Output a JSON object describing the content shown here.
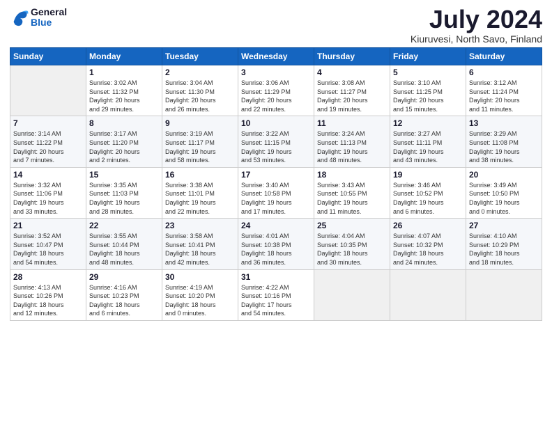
{
  "logo": {
    "line1": "General",
    "line2": "Blue"
  },
  "title": "July 2024",
  "subtitle": "Kiuruvesi, North Savo, Finland",
  "days_of_week": [
    "Sunday",
    "Monday",
    "Tuesday",
    "Wednesday",
    "Thursday",
    "Friday",
    "Saturday"
  ],
  "weeks": [
    [
      {
        "day": "",
        "info": ""
      },
      {
        "day": "1",
        "info": "Sunrise: 3:02 AM\nSunset: 11:32 PM\nDaylight: 20 hours\nand 29 minutes."
      },
      {
        "day": "2",
        "info": "Sunrise: 3:04 AM\nSunset: 11:30 PM\nDaylight: 20 hours\nand 26 minutes."
      },
      {
        "day": "3",
        "info": "Sunrise: 3:06 AM\nSunset: 11:29 PM\nDaylight: 20 hours\nand 22 minutes."
      },
      {
        "day": "4",
        "info": "Sunrise: 3:08 AM\nSunset: 11:27 PM\nDaylight: 20 hours\nand 19 minutes."
      },
      {
        "day": "5",
        "info": "Sunrise: 3:10 AM\nSunset: 11:25 PM\nDaylight: 20 hours\nand 15 minutes."
      },
      {
        "day": "6",
        "info": "Sunrise: 3:12 AM\nSunset: 11:24 PM\nDaylight: 20 hours\nand 11 minutes."
      }
    ],
    [
      {
        "day": "7",
        "info": "Sunrise: 3:14 AM\nSunset: 11:22 PM\nDaylight: 20 hours\nand 7 minutes."
      },
      {
        "day": "8",
        "info": "Sunrise: 3:17 AM\nSunset: 11:20 PM\nDaylight: 20 hours\nand 2 minutes."
      },
      {
        "day": "9",
        "info": "Sunrise: 3:19 AM\nSunset: 11:17 PM\nDaylight: 19 hours\nand 58 minutes."
      },
      {
        "day": "10",
        "info": "Sunrise: 3:22 AM\nSunset: 11:15 PM\nDaylight: 19 hours\nand 53 minutes."
      },
      {
        "day": "11",
        "info": "Sunrise: 3:24 AM\nSunset: 11:13 PM\nDaylight: 19 hours\nand 48 minutes."
      },
      {
        "day": "12",
        "info": "Sunrise: 3:27 AM\nSunset: 11:11 PM\nDaylight: 19 hours\nand 43 minutes."
      },
      {
        "day": "13",
        "info": "Sunrise: 3:29 AM\nSunset: 11:08 PM\nDaylight: 19 hours\nand 38 minutes."
      }
    ],
    [
      {
        "day": "14",
        "info": "Sunrise: 3:32 AM\nSunset: 11:06 PM\nDaylight: 19 hours\nand 33 minutes."
      },
      {
        "day": "15",
        "info": "Sunrise: 3:35 AM\nSunset: 11:03 PM\nDaylight: 19 hours\nand 28 minutes."
      },
      {
        "day": "16",
        "info": "Sunrise: 3:38 AM\nSunset: 11:01 PM\nDaylight: 19 hours\nand 22 minutes."
      },
      {
        "day": "17",
        "info": "Sunrise: 3:40 AM\nSunset: 10:58 PM\nDaylight: 19 hours\nand 17 minutes."
      },
      {
        "day": "18",
        "info": "Sunrise: 3:43 AM\nSunset: 10:55 PM\nDaylight: 19 hours\nand 11 minutes."
      },
      {
        "day": "19",
        "info": "Sunrise: 3:46 AM\nSunset: 10:52 PM\nDaylight: 19 hours\nand 6 minutes."
      },
      {
        "day": "20",
        "info": "Sunrise: 3:49 AM\nSunset: 10:50 PM\nDaylight: 19 hours\nand 0 minutes."
      }
    ],
    [
      {
        "day": "21",
        "info": "Sunrise: 3:52 AM\nSunset: 10:47 PM\nDaylight: 18 hours\nand 54 minutes."
      },
      {
        "day": "22",
        "info": "Sunrise: 3:55 AM\nSunset: 10:44 PM\nDaylight: 18 hours\nand 48 minutes."
      },
      {
        "day": "23",
        "info": "Sunrise: 3:58 AM\nSunset: 10:41 PM\nDaylight: 18 hours\nand 42 minutes."
      },
      {
        "day": "24",
        "info": "Sunrise: 4:01 AM\nSunset: 10:38 PM\nDaylight: 18 hours\nand 36 minutes."
      },
      {
        "day": "25",
        "info": "Sunrise: 4:04 AM\nSunset: 10:35 PM\nDaylight: 18 hours\nand 30 minutes."
      },
      {
        "day": "26",
        "info": "Sunrise: 4:07 AM\nSunset: 10:32 PM\nDaylight: 18 hours\nand 24 minutes."
      },
      {
        "day": "27",
        "info": "Sunrise: 4:10 AM\nSunset: 10:29 PM\nDaylight: 18 hours\nand 18 minutes."
      }
    ],
    [
      {
        "day": "28",
        "info": "Sunrise: 4:13 AM\nSunset: 10:26 PM\nDaylight: 18 hours\nand 12 minutes."
      },
      {
        "day": "29",
        "info": "Sunrise: 4:16 AM\nSunset: 10:23 PM\nDaylight: 18 hours\nand 6 minutes."
      },
      {
        "day": "30",
        "info": "Sunrise: 4:19 AM\nSunset: 10:20 PM\nDaylight: 18 hours\nand 0 minutes."
      },
      {
        "day": "31",
        "info": "Sunrise: 4:22 AM\nSunset: 10:16 PM\nDaylight: 17 hours\nand 54 minutes."
      },
      {
        "day": "",
        "info": ""
      },
      {
        "day": "",
        "info": ""
      },
      {
        "day": "",
        "info": ""
      }
    ]
  ]
}
